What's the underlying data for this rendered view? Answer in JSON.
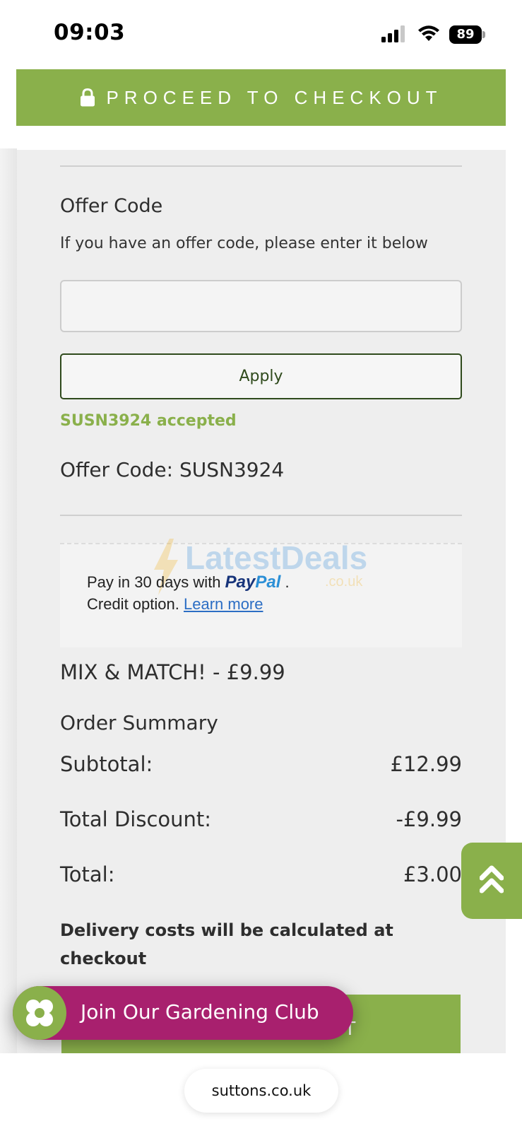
{
  "status_bar": {
    "time": "09:03",
    "battery": "89"
  },
  "header": {
    "checkout_label": "PROCEED TO CHECKOUT"
  },
  "offer": {
    "title": "Offer Code",
    "description": "If you have an offer code, please enter it below",
    "input_value": "",
    "apply_label": "Apply",
    "accepted_message": "SUSN3924 accepted",
    "applied_code": "Offer Code: SUSN3924"
  },
  "paypal": {
    "line1_prefix": "Pay in 30 days with",
    "brand_pay": "Pay",
    "brand_pal": "Pal",
    "line1_suffix": ".",
    "line2_prefix": "Credit option.",
    "learn_more": "Learn more"
  },
  "watermark": {
    "text": "LatestDeals",
    "sub": ".co.uk"
  },
  "promo": {
    "line": "MIX & MATCH! - £9.99"
  },
  "summary": {
    "title": "Order Summary",
    "rows": [
      {
        "label": "Subtotal:",
        "value": "£12.99"
      },
      {
        "label": "Total Discount:",
        "value": "-£9.99"
      },
      {
        "label": "Total:",
        "value": "£3.00"
      }
    ],
    "delivery_note": "Delivery costs will be calculated at checkout"
  },
  "footer": {
    "checkout_label_visible": "UT",
    "club_label": "Join Our Gardening Club"
  },
  "browser": {
    "url": "suttons.co.uk"
  },
  "colors": {
    "brand_green": "#8ab04b",
    "club_magenta": "#a8206e",
    "dark_green": "#2f4a1c"
  },
  "icons": [
    "lock-icon",
    "double-chevron-up-icon",
    "flower-icon",
    "signal-icon",
    "wifi-icon",
    "battery-icon"
  ]
}
